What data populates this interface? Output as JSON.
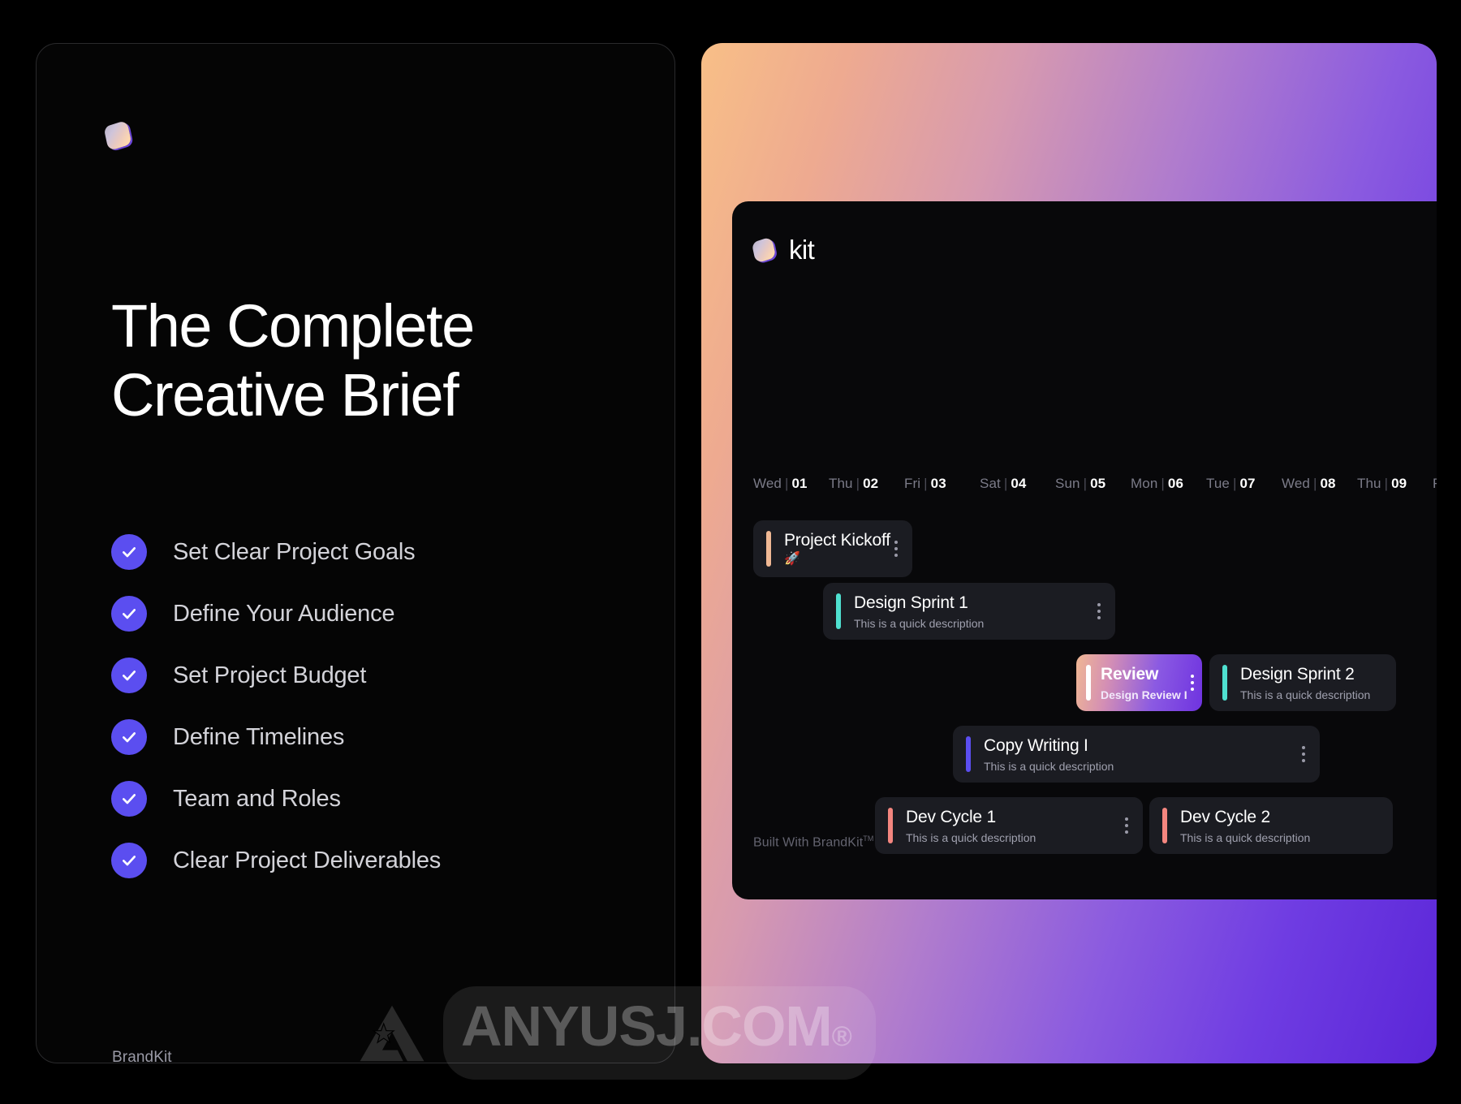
{
  "left_panel": {
    "logo_icon": "brandkit-gradient-square-icon",
    "headline_line1": "The Complete",
    "headline_line2": "Creative Brief",
    "checklist": [
      {
        "label": "Set Clear Project Goals",
        "icon": "check-icon",
        "checked": true
      },
      {
        "label": "Define Your Audience",
        "icon": "check-icon",
        "checked": true
      },
      {
        "label": "Set Project Budget",
        "icon": "check-icon",
        "checked": true
      },
      {
        "label": "Define Timelines",
        "icon": "check-icon",
        "checked": true
      },
      {
        "label": "Team and Roles",
        "icon": "check-icon",
        "checked": true
      },
      {
        "label": "Clear Project Deliverables",
        "icon": "check-icon",
        "checked": true
      }
    ],
    "footer": "BrandKit"
  },
  "right_panel": {
    "gradient_from": "#f8bf87",
    "gradient_to": "#5b26d8",
    "app": {
      "logo_icon": "brandkit-gradient-square-icon",
      "title": "kit",
      "timeline_days": [
        {
          "dow": "Wed",
          "sep": "|",
          "num": "01"
        },
        {
          "dow": "Thu",
          "sep": "|",
          "num": "02"
        },
        {
          "dow": "Fri",
          "sep": "|",
          "num": "03"
        },
        {
          "dow": "Sat",
          "sep": "|",
          "num": "04"
        },
        {
          "dow": "Sun",
          "sep": "|",
          "num": "05"
        },
        {
          "dow": "Mon",
          "sep": "|",
          "num": "06"
        },
        {
          "dow": "Tue",
          "sep": "|",
          "num": "07"
        },
        {
          "dow": "Wed",
          "sep": "|",
          "num": "08"
        },
        {
          "dow": "Thu",
          "sep": "|",
          "num": "09"
        },
        {
          "dow": "F",
          "sep": "",
          "num": ""
        }
      ],
      "tasks": [
        {
          "title": "Project Kickoff",
          "subtitle": "",
          "emoji": "🚀",
          "accent": "#f0b894",
          "style": "solid"
        },
        {
          "title": "Design Sprint 1",
          "subtitle": "This is a quick description",
          "emoji": "",
          "accent": "#4fe0d0",
          "style": "solid"
        },
        {
          "title": "Review",
          "subtitle": "Design Review I",
          "emoji": "",
          "accent": "#ffffff",
          "style": "gradient"
        },
        {
          "title": "Design Sprint 2",
          "subtitle": "This is a quick description",
          "emoji": "",
          "accent": "#4fe0d0",
          "style": "solid"
        },
        {
          "title": "Copy Writing I",
          "subtitle": "This is a quick description",
          "emoji": "",
          "accent": "#5b4ef0",
          "style": "solid"
        },
        {
          "title": "Dev Cycle 1",
          "subtitle": "This is a quick description",
          "emoji": "",
          "accent": "#f4867f",
          "style": "solid"
        },
        {
          "title": "Dev Cycle 2",
          "subtitle": "This is a quick description",
          "emoji": "",
          "accent": "#f4867f",
          "style": "solid"
        }
      ],
      "menu_icon": "kebab-menu-icon",
      "footer": "Built With BrandKit",
      "footer_tm": "TM"
    }
  },
  "watermark": {
    "logo_icon": "anyusj-triangle-star-icon",
    "text": "ANYUSJ.COM",
    "mark": "®"
  },
  "colors": {
    "accent_purple": "#5b4ef0",
    "accent_teal": "#4fe0d0",
    "accent_salmon": "#f4867f",
    "accent_peach": "#f0b894",
    "card_bg": "#17181d",
    "page_bg": "#000000"
  }
}
